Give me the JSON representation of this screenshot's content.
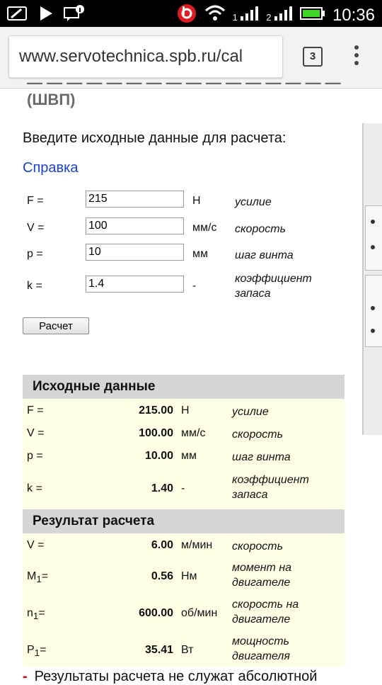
{
  "status_bar": {
    "time": "10:36",
    "signal1_label": "1",
    "signal2_label": "2"
  },
  "browser": {
    "url": "www.servotechnica.spb.ru/cal",
    "tab_count": "3"
  },
  "page": {
    "heading": "(ШВП)",
    "intro": "Введите исходные данные для расчета:",
    "help_link": "Справка",
    "inputs": [
      {
        "label": "F =",
        "value": "215",
        "unit": "Н",
        "desc": "усилие"
      },
      {
        "label": "V =",
        "value": "100",
        "unit": "мм/с",
        "desc": "скорость"
      },
      {
        "label": "p =",
        "value": "10",
        "unit": "мм",
        "desc": "шаг винта"
      },
      {
        "label": "k =",
        "value": "1.4",
        "unit": "-",
        "desc": "коэффициент запаса"
      }
    ],
    "calc_button": "Расчет",
    "source_section": {
      "title": "Исходные данные",
      "rows": [
        {
          "label": "F =",
          "value": "215.00",
          "unit": "Н",
          "desc": "усилие"
        },
        {
          "label": "V =",
          "value": "100.00",
          "unit": "мм/с",
          "desc": "скорость"
        },
        {
          "label": "p =",
          "value": "10.00",
          "unit": "мм",
          "desc": "шаг винта"
        },
        {
          "label": "k =",
          "value": "1.40",
          "unit": "-",
          "desc": "коэффициент запаса"
        }
      ]
    },
    "result_section": {
      "title": "Результат расчета",
      "rows": [
        {
          "label": "V =",
          "value": "6.00",
          "unit": "м/мин",
          "desc": "скорость"
        },
        {
          "label": "M",
          "sub": "1",
          "eq": "=",
          "value": "0.56",
          "unit": "Нм",
          "desc": "момент на двигателе"
        },
        {
          "label": "n",
          "sub": "1",
          "eq": "=",
          "value": "600.00",
          "unit": "об/мин",
          "desc": "скорость на двигателе"
        },
        {
          "label": "P",
          "sub": "1",
          "eq": "=",
          "value": "35.41",
          "unit": "Вт",
          "desc": "мощность двигателя"
        }
      ]
    },
    "footnote": "Результаты расчета не служат абсолютной"
  },
  "colors": {
    "link": "#1a3fd6",
    "section_header_bg": "#d6d6d6",
    "section_body_bg": "#ffffe6",
    "footnote_dash": "#d40000"
  }
}
